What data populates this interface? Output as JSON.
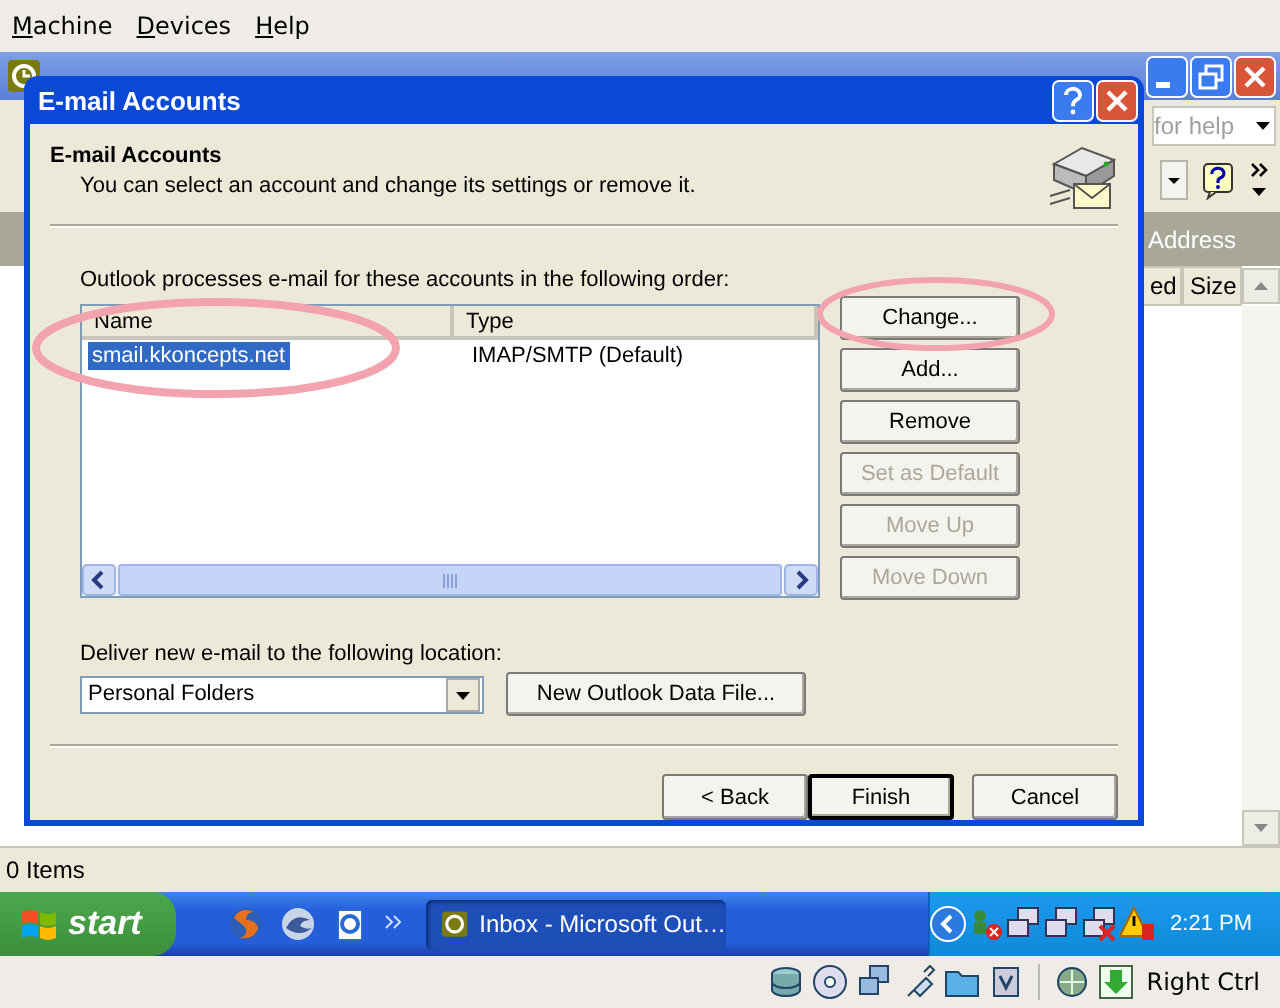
{
  "vm_menu": [
    {
      "label": "Machine"
    },
    {
      "label": "Devices"
    },
    {
      "label": "Help"
    }
  ],
  "outlook": {
    "help_field": {
      "value": "for help"
    },
    "header_bar": {
      "label": "Address"
    },
    "list_columns": [
      "ed",
      "Size"
    ],
    "status_bar": "0 Items"
  },
  "dialog": {
    "title": "E-mail Accounts",
    "heading": "E-mail Accounts",
    "subtitle": "You can select an account and change its settings or remove it.",
    "list_label": "Outlook processes e-mail for these accounts in the following order:",
    "list": {
      "columns": [
        "Name",
        "Type"
      ],
      "rows": [
        {
          "name": "smail.kkoncepts.net",
          "type": "IMAP/SMTP (Default)",
          "selected": true
        }
      ]
    },
    "side_buttons": [
      {
        "label": "Change...",
        "disabled": false
      },
      {
        "label": "Add...",
        "disabled": false
      },
      {
        "label": "Remove",
        "disabled": false
      },
      {
        "label": "Set as Default",
        "disabled": true
      },
      {
        "label": "Move Up",
        "disabled": true
      },
      {
        "label": "Move Down",
        "disabled": true
      }
    ],
    "deliver_label": "Deliver new e-mail to the following location:",
    "deliver_location": {
      "value": "Personal Folders"
    },
    "new_file_button": "New Outlook Data File...",
    "buttons": [
      {
        "label": "< Back",
        "default": false
      },
      {
        "label": "Finish",
        "default": true
      },
      {
        "label": "Cancel",
        "default": false
      }
    ]
  },
  "taskbar": {
    "start": "start",
    "tasks": [
      {
        "label": "Inbox - Microsoft Out…",
        "selected": true
      }
    ],
    "clock": "2:21 PM"
  },
  "vm_status": {
    "host_key": "Right Ctrl"
  }
}
